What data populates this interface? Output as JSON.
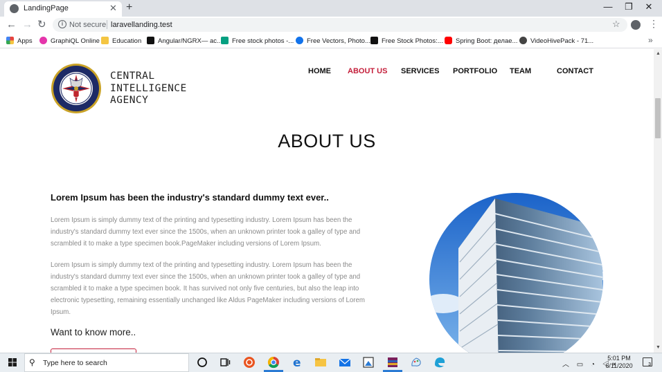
{
  "browser": {
    "tab_title": "LandingPage",
    "tab_close": "✕",
    "new_tab": "+",
    "window_minimize": "—",
    "window_restore": "❐",
    "window_close": "✕",
    "security_label": "Not secure",
    "url": "laravellanding.test",
    "bookmarks_more": "»",
    "bookmarks": [
      {
        "label": "Apps",
        "icon": "apps-grid-icon",
        "color": "#e8453c"
      },
      {
        "label": "GraphiQL Online",
        "icon": "graphiql-icon",
        "color": "#e535ab"
      },
      {
        "label": "Education",
        "icon": "folder-icon",
        "color": "#f4c542"
      },
      {
        "label": "Angular/NGRX— ас...",
        "icon": "medium-icon",
        "color": "#111111"
      },
      {
        "label": "Free stock photos -...",
        "icon": "pexels-icon",
        "color": "#05a081"
      },
      {
        "label": "Free Vectors, Photo...",
        "icon": "freepik-icon",
        "color": "#1273eb"
      },
      {
        "label": "Free Stock Photos:...",
        "icon": "burst-icon",
        "color": "#111111"
      },
      {
        "label": "Spring Boot: делае...",
        "icon": "youtube-icon",
        "color": "#ff0000"
      },
      {
        "label": "VideoHivePack - 71...",
        "icon": "videohive-icon",
        "color": "#444444"
      }
    ]
  },
  "page": {
    "brand_lines": [
      "CENTRAL",
      "INTELLIGENCE",
      "AGENCY"
    ],
    "nav": [
      {
        "label": "HOME",
        "active": false
      },
      {
        "label": "ABOUT US",
        "active": true
      },
      {
        "label": "SERVICES",
        "active": false
      },
      {
        "label": "PORTFOLIO",
        "active": false
      },
      {
        "label": "TEAM",
        "active": false
      },
      {
        "label": "CONTACT",
        "active": false
      }
    ],
    "section_title": "ABOUT US",
    "lead": "Lorem Ipsum has been the industry's standard dummy text ever..",
    "paragraph_1": "Lorem Ipsum is simply dummy text of the printing and typesetting industry. Lorem Ipsum has been the industry's standard dummy text ever since the 1500s, when an unknown printer took a galley of type and scrambled it to make a type specimen book.PageMaker including versions of Lorem Ipsum.",
    "paragraph_2": "Lorem Ipsum is simply dummy text of the printing and typesetting industry. Lorem Ipsum has been the industry's standard dummy text ever since the 1500s, when an unknown printer took a galley of type and scrambled it to make a type specimen book. It has survived not only five centuries, but also the leap into electronic typesetting, remaining essentially unchanged like Aldus PageMaker including versions of Lorem Ipsum.",
    "more_heading": "Want to know more..",
    "accent_color": "#c41e3a"
  },
  "taskbar": {
    "search_placeholder": "Type here to search",
    "time": "5:01 PM",
    "date": "6/11/2020",
    "notification_count": "3",
    "apps": [
      "cortana-icon",
      "task-view-icon",
      "ubuntu-icon",
      "chrome-icon",
      "edge-icon",
      "file-explorer-icon",
      "mail-icon",
      "screenshot-tool-icon",
      "winrar-icon",
      "paint-icon",
      "edge-beta-icon"
    ]
  }
}
